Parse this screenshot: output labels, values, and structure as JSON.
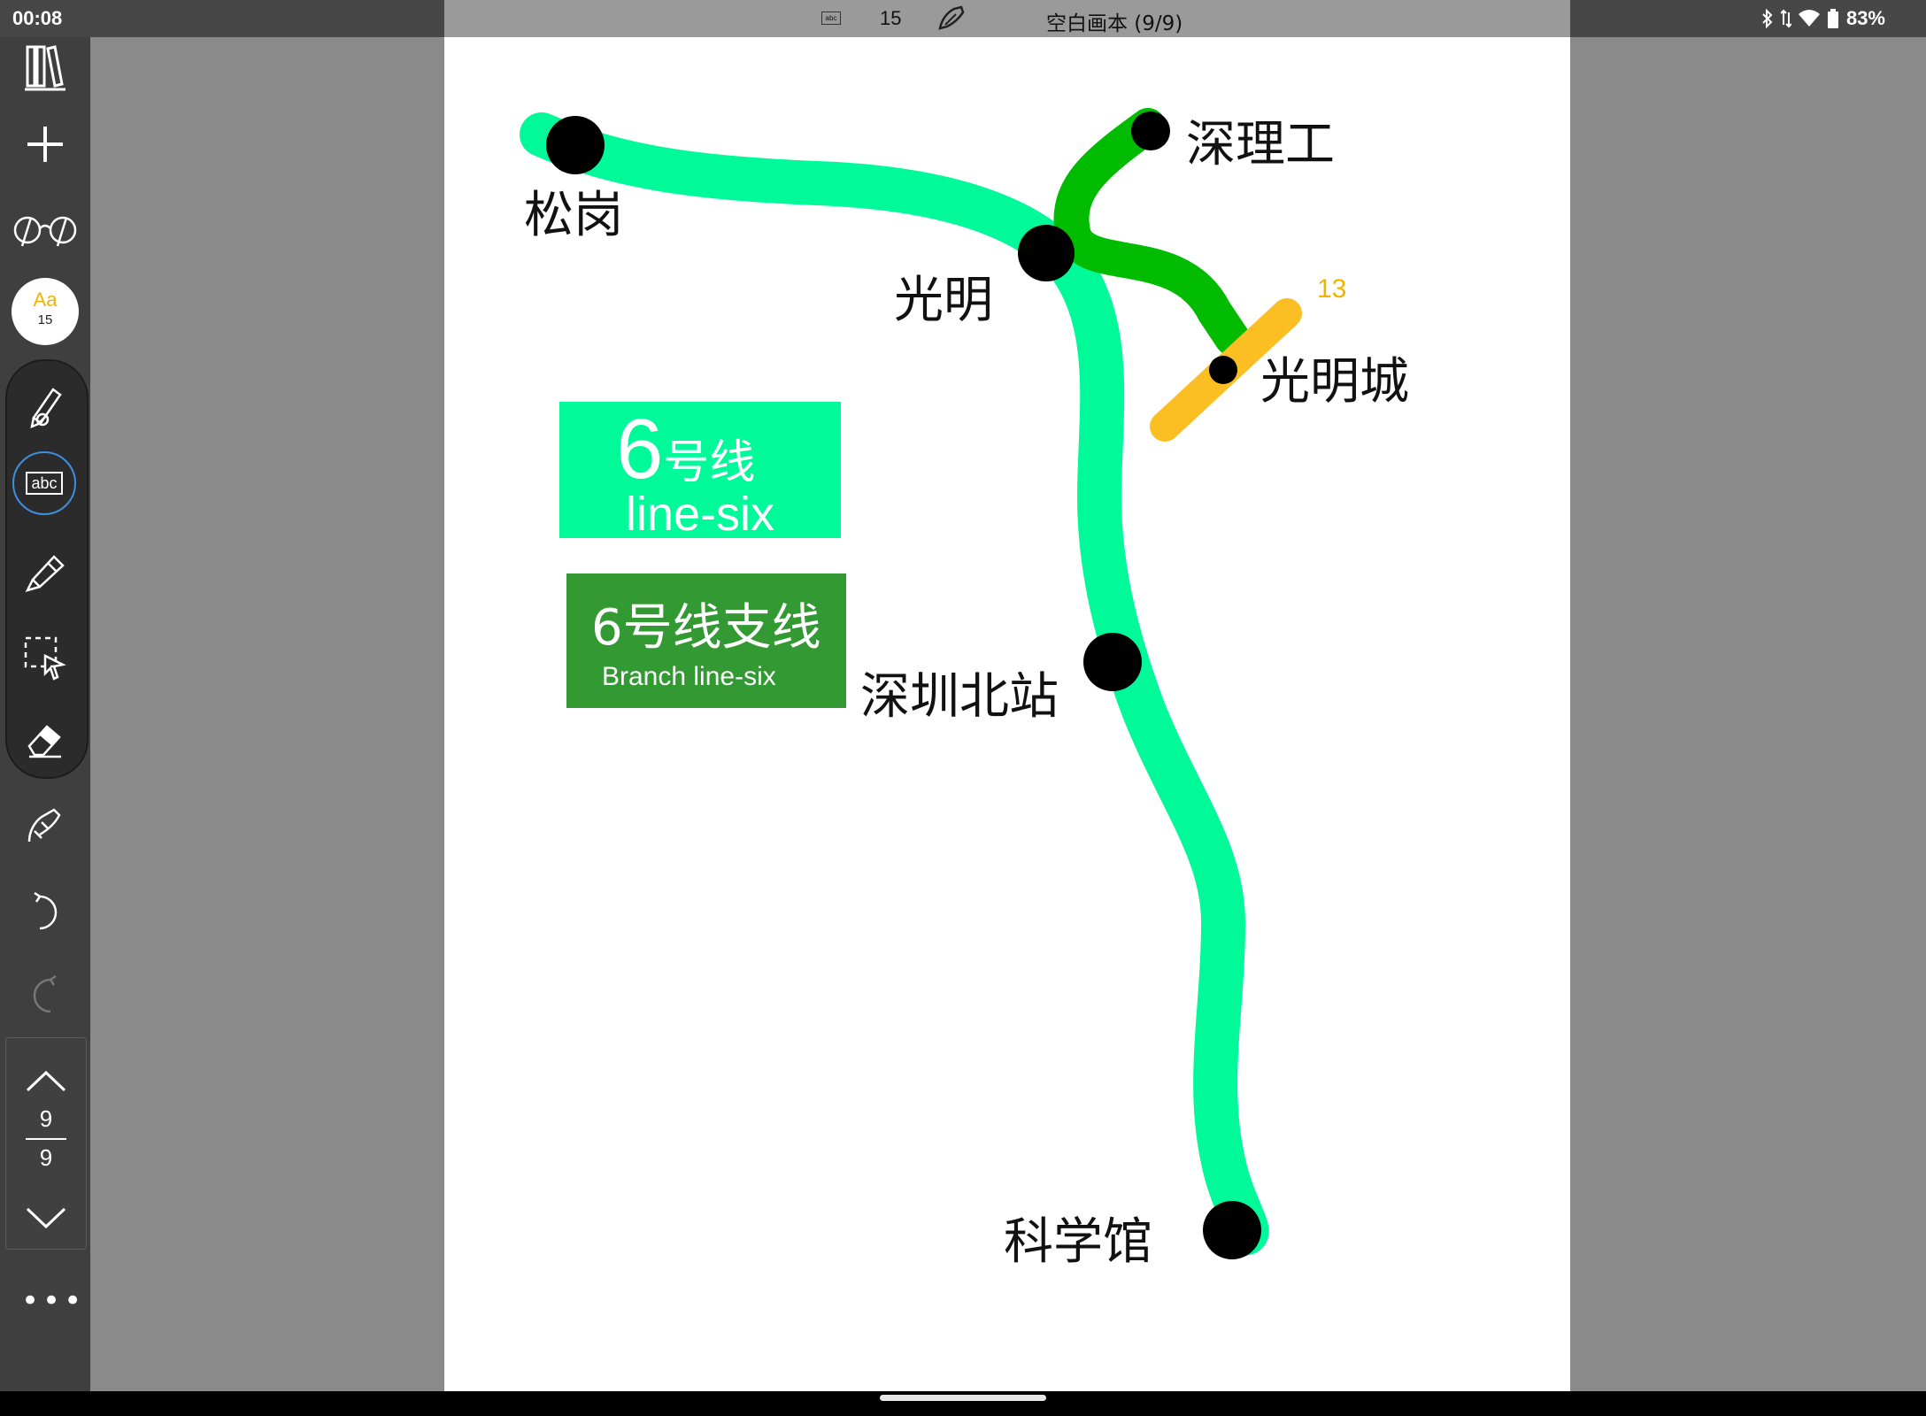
{
  "status_bar": {
    "time": "00:08",
    "abc_icon_text": "abc",
    "font_size": "15",
    "title": "空白画本 (9/9)",
    "battery": "83%"
  },
  "toolbar": {
    "font_button": {
      "label": "Aa",
      "size": "15"
    },
    "abc_tool_label": "abc",
    "pager": {
      "current": "9",
      "total": "9"
    },
    "more_label": "•••"
  },
  "colors": {
    "line_six": "#00fa9a",
    "line_six_branch": "#00bb00",
    "line_13": "#fbbf24",
    "legend_branch_bg": "#339933"
  },
  "map": {
    "stations": {
      "songgang": "松岗",
      "guangming": "光明",
      "shenligong": "深理工",
      "guangmingcheng": "光明城",
      "shenzhen_north": "深圳北站",
      "science_museum": "科学馆"
    },
    "line13_label": "13",
    "legend_line6": {
      "number": "6",
      "cn": "号线",
      "en": "line-six"
    },
    "legend_branch": {
      "cn": "6号线支线",
      "en": "Branch line-six"
    }
  }
}
